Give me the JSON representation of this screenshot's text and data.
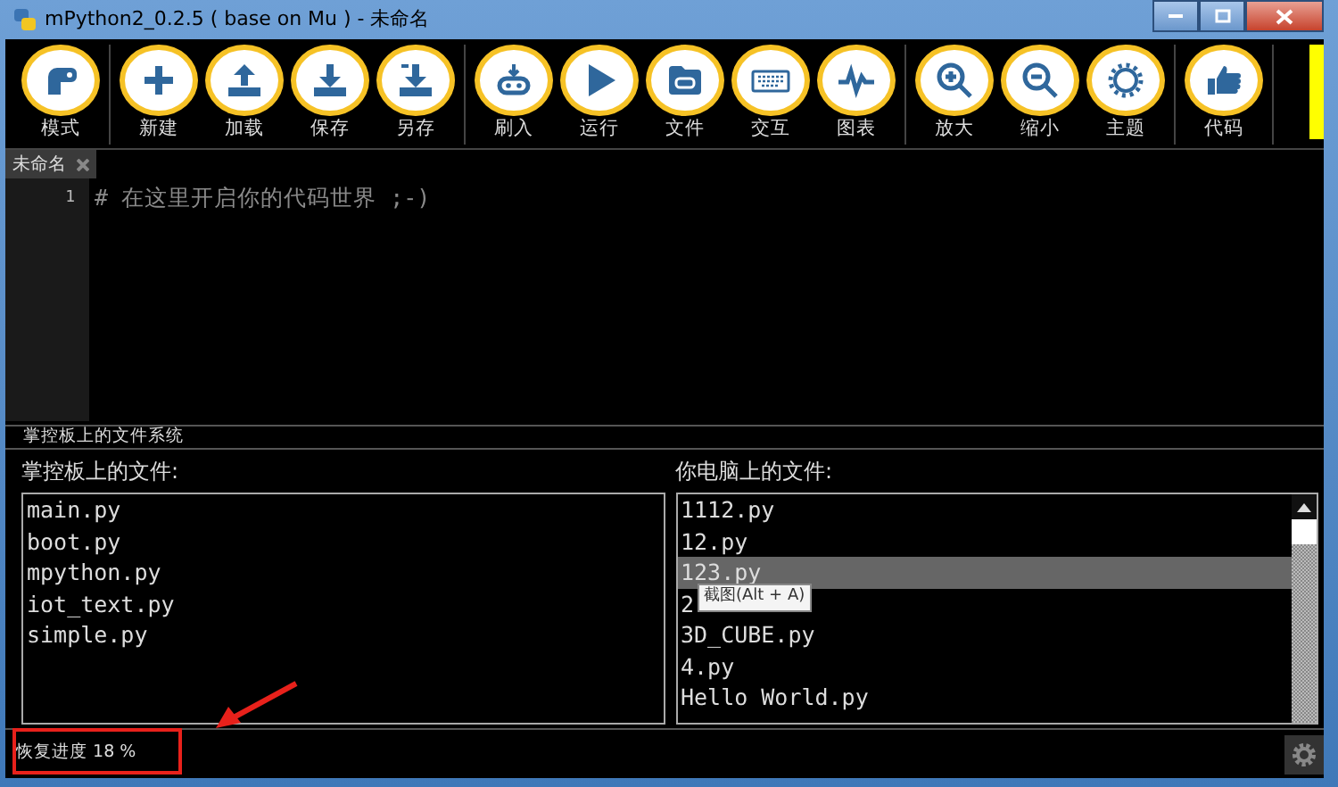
{
  "window": {
    "title": "mPython2_0.2.5 ( base on Mu ) - 未命名"
  },
  "toolbar": {
    "groups": [
      [
        {
          "label": "模式"
        }
      ],
      [
        {
          "label": "新建"
        },
        {
          "label": "加载"
        },
        {
          "label": "保存"
        },
        {
          "label": "另存"
        }
      ],
      [
        {
          "label": "刷入"
        },
        {
          "label": "运行"
        },
        {
          "label": "文件"
        },
        {
          "label": "交互"
        },
        {
          "label": "图表"
        }
      ],
      [
        {
          "label": "放大"
        },
        {
          "label": "缩小"
        },
        {
          "label": "主题"
        }
      ],
      [
        {
          "label": "代码"
        }
      ]
    ]
  },
  "tabs": [
    {
      "label": "未命名",
      "selected": true
    }
  ],
  "editor": {
    "line_numbers": [
      "1"
    ],
    "lines": [
      "# 在这里开启你的代码世界 ;-)"
    ]
  },
  "filesystem": {
    "title": "掌控板上的文件系统",
    "device": {
      "heading": "掌控板上的文件:",
      "files": [
        {
          "name": "main.py"
        },
        {
          "name": "boot.py"
        },
        {
          "name": "mpython.py"
        },
        {
          "name": "iot_text.py"
        },
        {
          "name": "simple.py"
        }
      ]
    },
    "computer": {
      "heading": "你电脑上的文件:",
      "files": [
        {
          "name": "1112.py",
          "selected": false
        },
        {
          "name": "12.py",
          "selected": false
        },
        {
          "name": "123.py",
          "selected": true
        },
        {
          "name": "2",
          "selected": false
        },
        {
          "name": "3D_CUBE.py",
          "selected": false
        },
        {
          "name": "4.py",
          "selected": false
        },
        {
          "name": "Hello World.py",
          "selected": false
        }
      ]
    },
    "tooltip": "截图(Alt + A)"
  },
  "status_bar": {
    "text": "恢复进度 18 %"
  }
}
